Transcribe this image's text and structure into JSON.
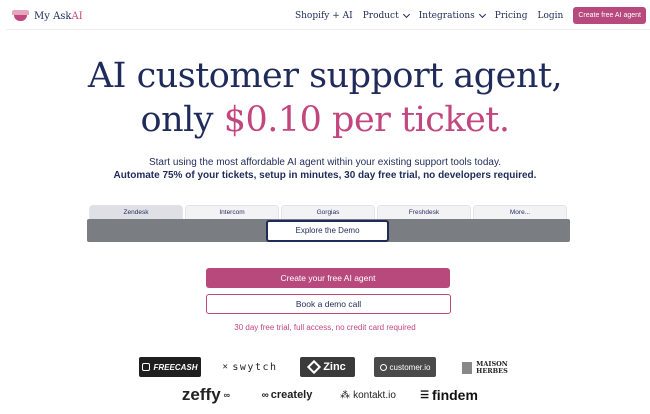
{
  "brand": {
    "name": "My Ask",
    "name_suffix": "AI"
  },
  "nav": {
    "links": [
      {
        "label": "Shopify + AI"
      },
      {
        "label": "Product"
      },
      {
        "label": "Integrations"
      },
      {
        "label": "Pricing"
      },
      {
        "label": "Login"
      }
    ],
    "cta": "Create free AI agent"
  },
  "hero": {
    "line1": "AI customer support agent,",
    "line2_a": "only ",
    "line2_b": "$0.10 per ticket.",
    "sub1": "Start using the most affordable AI agent within your existing support tools today.",
    "sub2": "Automate 75% of your tickets, setup in minutes, 30 day free trial, no developers required."
  },
  "demo": {
    "tabs": [
      "Zendesk",
      "Intercom",
      "Gorgias",
      "Freshdesk",
      "More..."
    ],
    "active_tab": "Zendesk",
    "explore_label": "Explore the Demo"
  },
  "cta": {
    "primary": "Create your free AI agent",
    "secondary": "Book a demo call",
    "fine_print": "30 day free trial, full access, no credit card required"
  },
  "logos": {
    "freecash": "FREECASH",
    "swytch": "swytch",
    "zinc": "Zinc",
    "customerio": "customer.io",
    "maison_1": "MAISON",
    "maison_2": "HERBES",
    "zeffy": "zeffy",
    "creately": "creately",
    "kontakt": "kontakt.io",
    "findem": "findem"
  },
  "colors": {
    "navy": "#1f2b5a",
    "pink": "#c2477f",
    "cta_bg": "#b8497c"
  }
}
